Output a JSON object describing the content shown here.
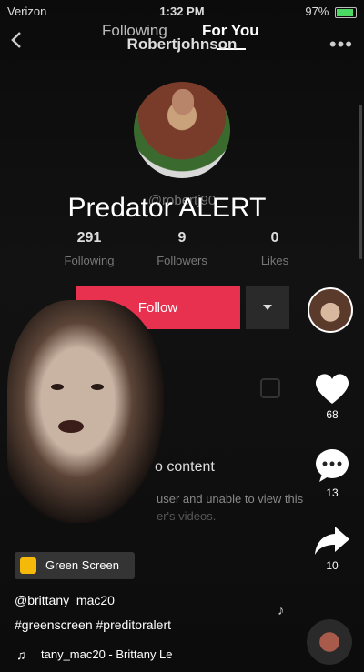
{
  "status_bar": {
    "carrier": "Verizon",
    "time": "1:32 PM",
    "battery": "97%"
  },
  "nav": {
    "tab_following": "Following",
    "tab_for_you": "For You",
    "profile_name": "Robertjohnson"
  },
  "profile": {
    "handle": "@robertj90",
    "overlay_title": "Predator ALERT",
    "stats": [
      {
        "value": "291",
        "label": "Following"
      },
      {
        "value": "9",
        "label": "Followers"
      },
      {
        "value": "0",
        "label": "Likes"
      }
    ],
    "follow_label": "Follow"
  },
  "private_notice": {
    "title": "o content",
    "line1": "user and unable to view this",
    "line2": "er's videos."
  },
  "rail": {
    "likes": "68",
    "comments": "13",
    "shares": "10"
  },
  "video": {
    "effect_label": "Green Screen",
    "author": "@brittany_mac20",
    "caption": "#greenscreen #preditoralert",
    "music": "tany_mac20 - Brittany Le"
  },
  "colors": {
    "follow": "#e8304f",
    "accent_yellow": "#f5b90a"
  }
}
